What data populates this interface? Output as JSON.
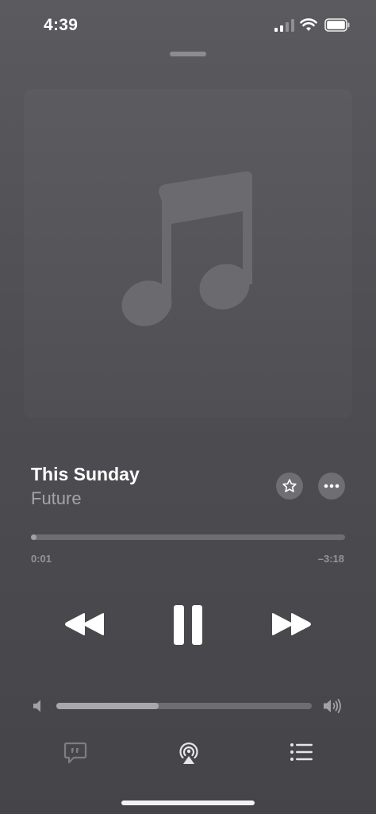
{
  "status_bar": {
    "time": "4:39"
  },
  "now_playing": {
    "title": "This Sunday",
    "artist": "Future",
    "elapsed": "0:01",
    "remaining": "–3:18",
    "progress_fraction": 0.01
  },
  "volume": {
    "level_fraction": 0.4
  },
  "colors": {
    "background": "#4d4d52",
    "artwork": "#57575c",
    "track": "#6d6d72"
  },
  "icons": {
    "artwork": "music-note-icon",
    "favorite": "star-icon",
    "more": "ellipsis-icon",
    "rewind": "rewind-icon",
    "pause": "pause-icon",
    "forward": "fast-forward-icon",
    "lyrics": "lyrics-icon",
    "airplay": "airplay-icon",
    "queue": "queue-list-icon"
  }
}
